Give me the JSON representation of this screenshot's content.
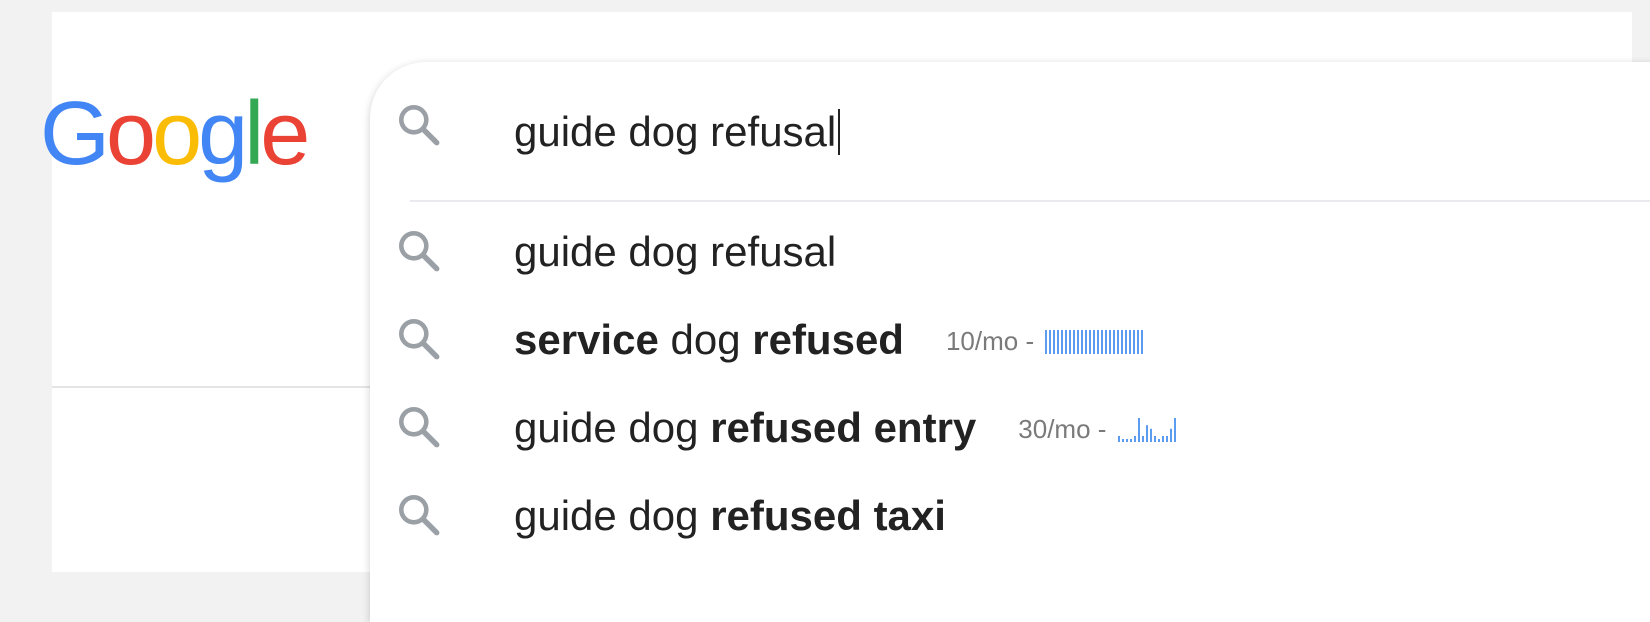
{
  "logo": {
    "letters": [
      "G",
      "o",
      "o",
      "g",
      "l",
      "e"
    ],
    "colors": [
      "#4285F4",
      "#EA4335",
      "#FBBC05",
      "#4285F4",
      "#34A853",
      "#EA4335"
    ]
  },
  "search": {
    "query": "guide dog refusal",
    "icon": "search-icon"
  },
  "suggestions": [
    {
      "parts": [
        {
          "text": "guide dog refusal",
          "bold": false
        }
      ],
      "volume": "",
      "trend": []
    },
    {
      "parts": [
        {
          "text": "service",
          "bold": true
        },
        {
          "text": " dog ",
          "bold": false
        },
        {
          "text": "refused",
          "bold": true
        }
      ],
      "volume": "10/mo - ",
      "trend": [
        1,
        1,
        1,
        1,
        1,
        1,
        1,
        1,
        1,
        1,
        1,
        1,
        1,
        1,
        1,
        1,
        1,
        1,
        1,
        1,
        1,
        1,
        1,
        1,
        1
      ]
    },
    {
      "parts": [
        {
          "text": "guide dog ",
          "bold": false
        },
        {
          "text": "refused entry",
          "bold": true
        }
      ],
      "volume": "30/mo - ",
      "trend": [
        0.25,
        0.1,
        0.1,
        0.1,
        0.25,
        1,
        0.25,
        0.7,
        0.55,
        0.25,
        0.1,
        0.25,
        0.25,
        0.55,
        1
      ]
    },
    {
      "parts": [
        {
          "text": "guide dog ",
          "bold": false
        },
        {
          "text": "refused taxi",
          "bold": true
        }
      ],
      "volume": "",
      "trend": []
    }
  ],
  "colors": {
    "trend_bar": "#5b9bf0",
    "icon_gray": "#9aa0a6"
  }
}
